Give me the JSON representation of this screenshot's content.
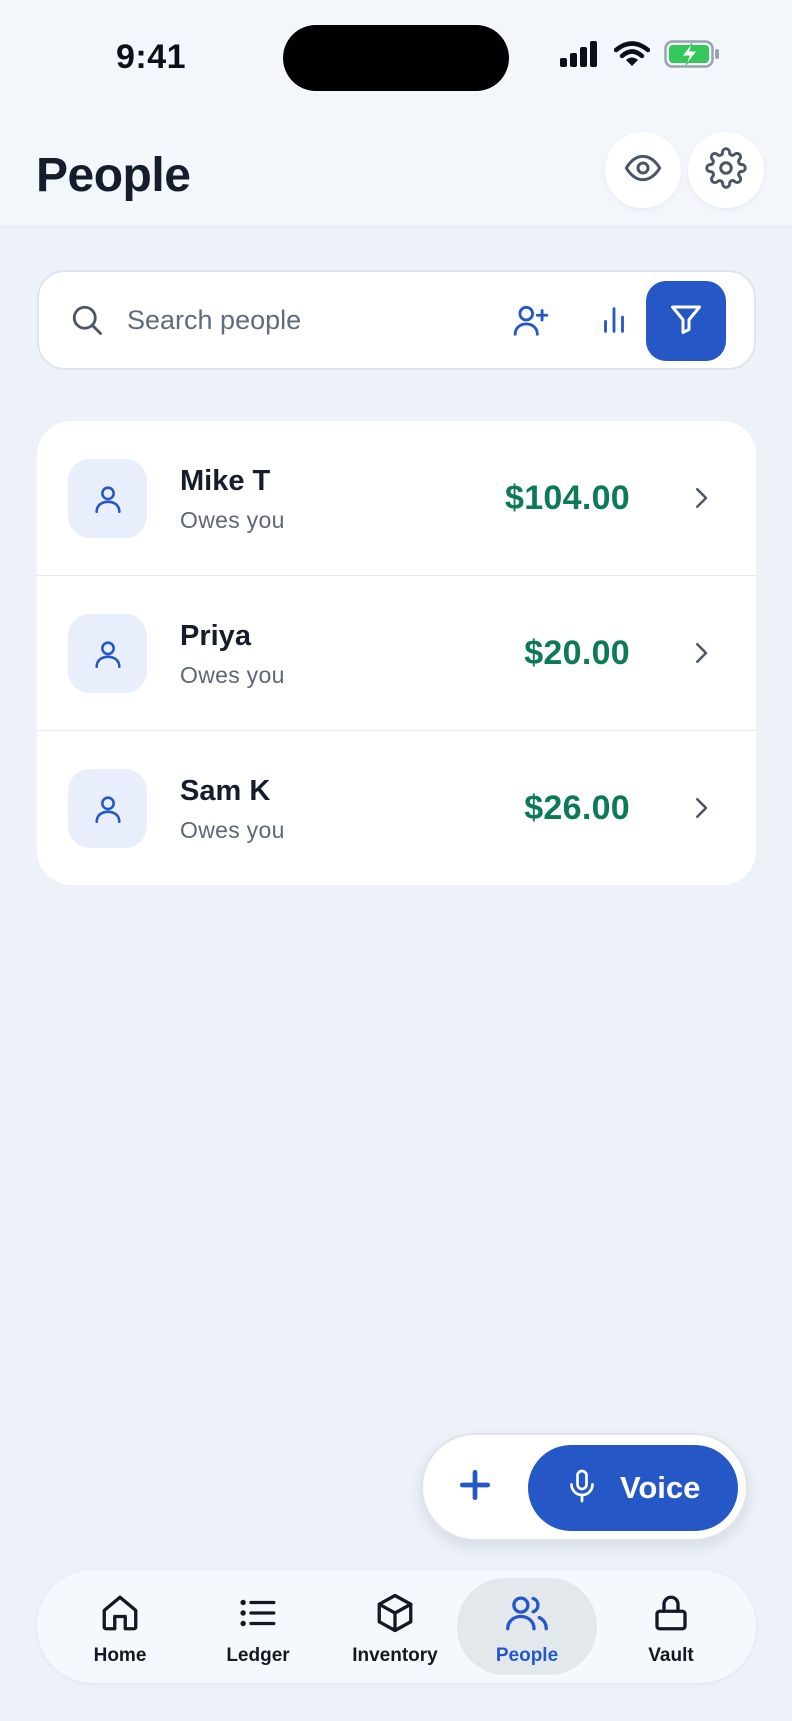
{
  "status_bar": {
    "time": "9:41",
    "icons": [
      "cellular-signal-icon",
      "wifi-icon",
      "battery-charging-icon"
    ]
  },
  "header": {
    "title": "People",
    "actions": [
      "eye-icon",
      "gear-icon"
    ]
  },
  "search": {
    "placeholder": "Search people",
    "value": "",
    "tools": [
      "add-person-icon",
      "bar-chart-icon",
      "filter-icon"
    ]
  },
  "people": [
    {
      "name": "Mike T",
      "status": "Owes you",
      "amount": "$104.00"
    },
    {
      "name": "Priya",
      "status": "Owes you",
      "amount": "$20.00"
    },
    {
      "name": "Sam K",
      "status": "Owes you",
      "amount": "$26.00"
    }
  ],
  "fab": {
    "add_icon": "plus-icon",
    "voice_label": "Voice",
    "voice_icon": "microphone-icon"
  },
  "nav": {
    "items": [
      {
        "label": "Home",
        "icon": "home-icon",
        "active": false
      },
      {
        "label": "Ledger",
        "icon": "list-icon",
        "active": false
      },
      {
        "label": "Inventory",
        "icon": "box-icon",
        "active": false
      },
      {
        "label": "People",
        "icon": "people-icon",
        "active": true
      },
      {
        "label": "Vault",
        "icon": "lock-icon",
        "active": false
      }
    ]
  },
  "colors": {
    "accent": "#2657c7",
    "positive_amount": "#0d7a57",
    "background": "#edf1f8",
    "battery": "#34c759"
  }
}
